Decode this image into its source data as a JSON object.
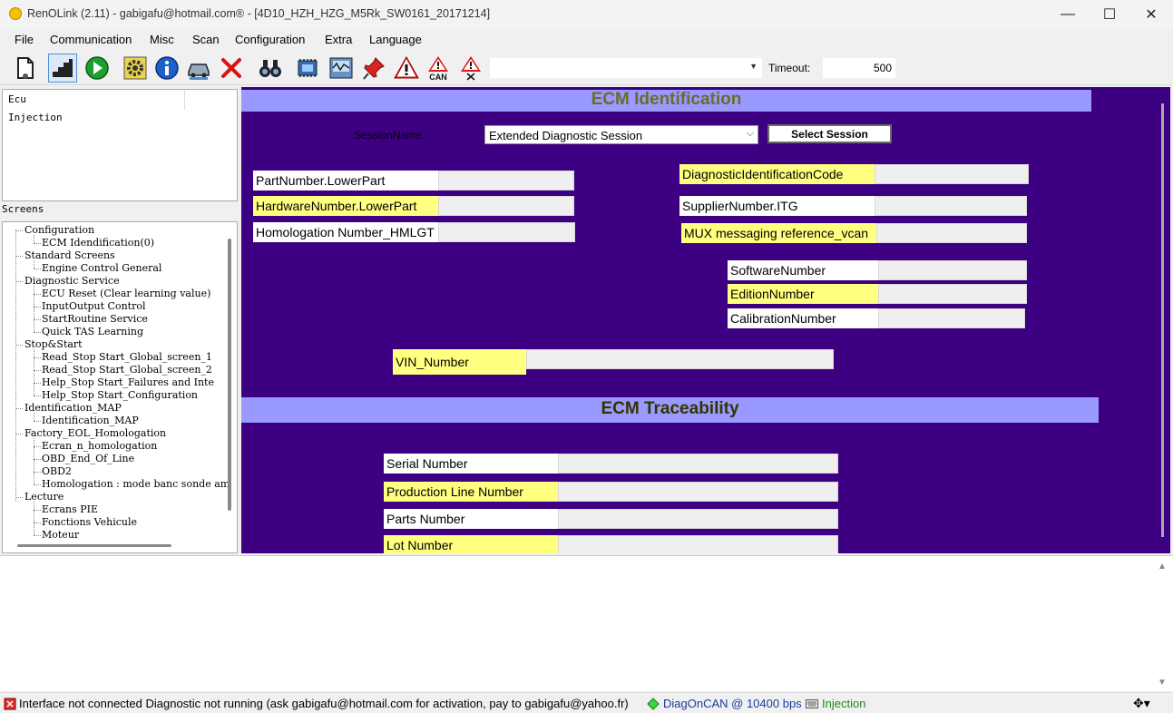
{
  "window": {
    "title": "RenOLink (2.11) - gabigafu@hotmail.com® -  [4D10_HZH_HZG_M5Rk_SW0161_20171214]",
    "minimize": "—",
    "maximize": "☐",
    "close": "✕"
  },
  "menu": [
    "File",
    "Communication",
    "Misc",
    "Scan",
    "Configuration",
    "Extra",
    "Language"
  ],
  "toolbar": {
    "timeout_label": "Timeout:",
    "timeout_value": "500",
    "combo_value": "",
    "can_label": "CAN",
    "icons": [
      "open-document-icon",
      "stairs-icon",
      "play-icon",
      "gear-icon",
      "info-icon",
      "vehicle-icon",
      "stop-icon",
      "binoculars-icon",
      "ecu-chip-icon",
      "oscilloscope-icon",
      "pin-icon",
      "warning-icon",
      "can-warning-icon",
      "warning-clear-icon"
    ]
  },
  "ecu_list": {
    "header": "Ecu",
    "items": [
      "Injection"
    ]
  },
  "screens": {
    "label": "Screens",
    "tree": [
      {
        "label": "Configuration",
        "level": 0
      },
      {
        "label": "ECM Idendification(0)",
        "level": 1
      },
      {
        "label": "Standard Screens",
        "level": 0
      },
      {
        "label": "Engine Control General",
        "level": 1
      },
      {
        "label": "Diagnostic Service",
        "level": 0
      },
      {
        "label": "ECU Reset (Clear learning value)",
        "level": 1
      },
      {
        "label": "InputOutput Control",
        "level": 1
      },
      {
        "label": "StartRoutine Service",
        "level": 1
      },
      {
        "label": "Quick TAS Learning",
        "level": 1
      },
      {
        "label": "Stop&Start",
        "level": 0
      },
      {
        "label": "Read_Stop Start_Global_screen_1",
        "level": 1
      },
      {
        "label": "Read_Stop Start_Global_screen_2",
        "level": 1
      },
      {
        "label": "Help_Stop Start_Failures and Inte",
        "level": 1
      },
      {
        "label": "Help_Stop Start_Configuration",
        "level": 1
      },
      {
        "label": "Identification_MAP",
        "level": 0
      },
      {
        "label": "Identification_MAP",
        "level": 1
      },
      {
        "label": "Factory_EOL_Homologation",
        "level": 0
      },
      {
        "label": "Ecran_n_homologation",
        "level": 1
      },
      {
        "label": "OBD_End_Of_Line",
        "level": 1
      },
      {
        "label": "OBD2",
        "level": 1
      },
      {
        "label": "Homologation : mode banc sonde am",
        "level": 1
      },
      {
        "label": "Lecture",
        "level": 0
      },
      {
        "label": "Ecrans PIE",
        "level": 1
      },
      {
        "label": "Fonctions Vehicule",
        "level": 1
      },
      {
        "label": "Moteur",
        "level": 1
      }
    ]
  },
  "identification": {
    "title": "ECM Identification",
    "session_label": "SessionName",
    "session_value": "Extended Diagnostic Session",
    "select_session_button": "Select Session",
    "fields": [
      {
        "label": "PartNumber.LowerPart",
        "value": "",
        "highlight": false
      },
      {
        "label": "HardwareNumber.LowerPart",
        "value": "",
        "highlight": true
      },
      {
        "label": "Homologation Number_HMLGT",
        "value": "",
        "highlight": false
      },
      {
        "label": "DiagnosticIdentificationCode",
        "value": "",
        "highlight": true
      },
      {
        "label": "SupplierNumber.ITG",
        "value": "",
        "highlight": false
      },
      {
        "label": "MUX messaging reference_vcan",
        "value": "",
        "highlight": true
      },
      {
        "label": "SoftwareNumber",
        "value": "",
        "highlight": false
      },
      {
        "label": "EditionNumber",
        "value": "",
        "highlight": true
      },
      {
        "label": "CalibrationNumber",
        "value": "",
        "highlight": false
      },
      {
        "label": "VIN_Number",
        "value": "",
        "highlight": true
      }
    ]
  },
  "traceability": {
    "title": "ECM Traceability",
    "fields": [
      {
        "label": "Serial Number",
        "value": "",
        "highlight": false
      },
      {
        "label": "Production Line Number",
        "value": "",
        "highlight": true
      },
      {
        "label": "Parts Number",
        "value": "",
        "highlight": false
      },
      {
        "label": "Lot Number",
        "value": "",
        "highlight": true
      }
    ]
  },
  "status": {
    "message": "Interface not connected Diagnostic not running (ask gabigafu@hotmail.com for activation, pay to gabigafu@yahoo.fr)",
    "protocol": "DiagOnCAN @ 10400 bps",
    "ecu": "Injection"
  },
  "colors": {
    "main_background": "#3d0082",
    "section_header": "#9999ff",
    "highlight_label": "#ffff80",
    "status_green": "#1a8a1a",
    "status_blue": "#1a3aa0"
  }
}
